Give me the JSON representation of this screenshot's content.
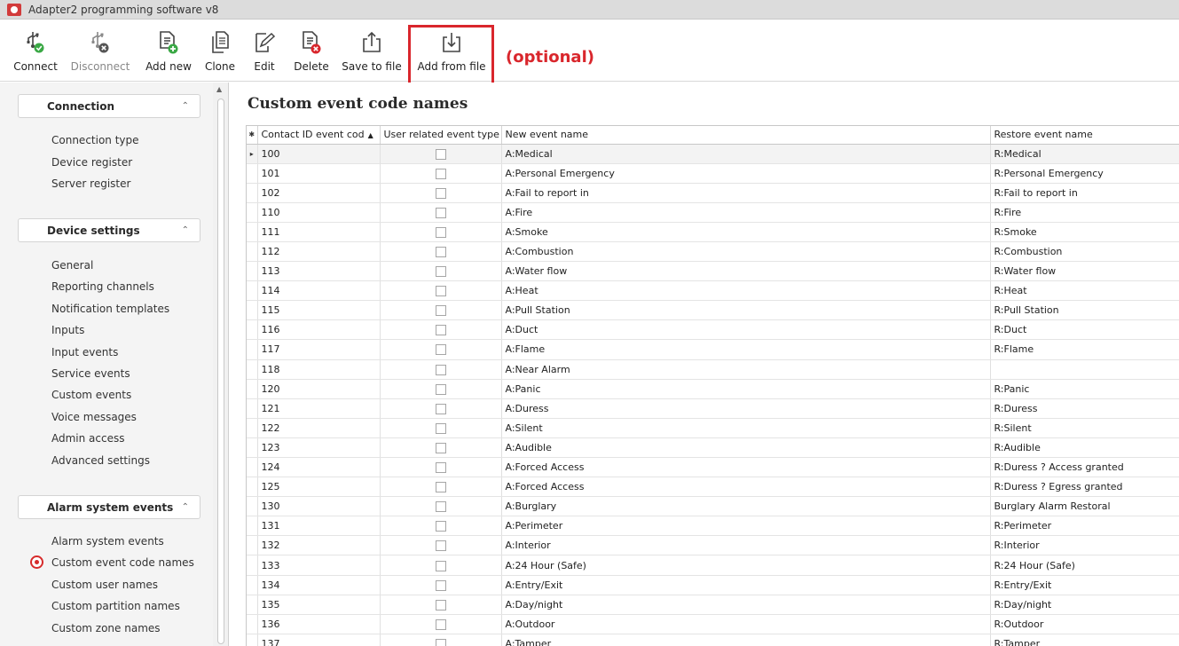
{
  "window": {
    "title": "Adapter2 programming software v8"
  },
  "toolbar": {
    "buttons": [
      {
        "id": "connect",
        "label": "Connect",
        "icon": "usb-connect-icon",
        "enabled": true
      },
      {
        "id": "disconnect",
        "label": "Disconnect",
        "icon": "usb-disconnect-icon",
        "enabled": false
      },
      {
        "id": "add-new",
        "label": "Add new",
        "icon": "document-add-icon",
        "enabled": true
      },
      {
        "id": "clone",
        "label": "Clone",
        "icon": "document-copy-icon",
        "enabled": true
      },
      {
        "id": "edit",
        "label": "Edit",
        "icon": "document-edit-icon",
        "enabled": true
      },
      {
        "id": "delete",
        "label": "Delete",
        "icon": "document-delete-icon",
        "enabled": true
      },
      {
        "id": "save-to-file",
        "label": "Save to file",
        "icon": "export-icon",
        "enabled": true
      },
      {
        "id": "add-from-file",
        "label": "Add from file",
        "icon": "import-icon",
        "enabled": true
      }
    ],
    "annotation": "(optional)"
  },
  "sidebar": {
    "sections": [
      {
        "title": "Connection",
        "items": [
          "Connection type",
          "Device register",
          "Server register"
        ]
      },
      {
        "title": "Device settings",
        "items": [
          "General",
          "Reporting channels",
          "Notification templates",
          "Inputs",
          "Input events",
          "Service events",
          "Custom events",
          "Voice messages",
          "Admin access",
          "Advanced settings"
        ]
      },
      {
        "title": "Alarm system events",
        "items": [
          "Alarm system events",
          "Custom event code names",
          "Custom user names",
          "Custom partition names",
          "Custom zone names"
        ]
      }
    ],
    "selected_item": "Custom event code names"
  },
  "main": {
    "title": "Custom event code names",
    "columns": [
      "Contact ID event cod",
      "User related event type",
      "New event name",
      "Restore event name"
    ],
    "sorted_column": "Contact ID event cod",
    "rows": [
      {
        "code": "100",
        "user_related": false,
        "new_name": "A:Medical",
        "restore_name": "R:Medical"
      },
      {
        "code": "101",
        "user_related": false,
        "new_name": "A:Personal Emergency",
        "restore_name": "R:Personal Emergency"
      },
      {
        "code": "102",
        "user_related": false,
        "new_name": "A:Fail to report in",
        "restore_name": "R:Fail to report in"
      },
      {
        "code": "110",
        "user_related": false,
        "new_name": "A:Fire",
        "restore_name": "R:Fire"
      },
      {
        "code": "111",
        "user_related": false,
        "new_name": "A:Smoke",
        "restore_name": "R:Smoke"
      },
      {
        "code": "112",
        "user_related": false,
        "new_name": "A:Combustion",
        "restore_name": "R:Combustion"
      },
      {
        "code": "113",
        "user_related": false,
        "new_name": "A:Water flow",
        "restore_name": "R:Water flow"
      },
      {
        "code": "114",
        "user_related": false,
        "new_name": "A:Heat",
        "restore_name": "R:Heat"
      },
      {
        "code": "115",
        "user_related": false,
        "new_name": "A:Pull Station",
        "restore_name": "R:Pull Station"
      },
      {
        "code": "116",
        "user_related": false,
        "new_name": "A:Duct",
        "restore_name": "R:Duct"
      },
      {
        "code": "117",
        "user_related": false,
        "new_name": "A:Flame",
        "restore_name": "R:Flame"
      },
      {
        "code": "118",
        "user_related": false,
        "new_name": "A:Near Alarm",
        "restore_name": ""
      },
      {
        "code": "120",
        "user_related": false,
        "new_name": "A:Panic",
        "restore_name": "R:Panic"
      },
      {
        "code": "121",
        "user_related": false,
        "new_name": "A:Duress",
        "restore_name": "R:Duress"
      },
      {
        "code": "122",
        "user_related": false,
        "new_name": "A:Silent",
        "restore_name": "R:Silent"
      },
      {
        "code": "123",
        "user_related": false,
        "new_name": "A:Audible",
        "restore_name": "R:Audible"
      },
      {
        "code": "124",
        "user_related": false,
        "new_name": "A:Forced Access",
        "restore_name": "R:Duress ? Access granted"
      },
      {
        "code": "125",
        "user_related": false,
        "new_name": "A:Forced Access",
        "restore_name": "R:Duress ? Egress granted"
      },
      {
        "code": "130",
        "user_related": false,
        "new_name": "A:Burglary",
        "restore_name": "Burglary Alarm Restoral"
      },
      {
        "code": "131",
        "user_related": false,
        "new_name": "A:Perimeter",
        "restore_name": "R:Perimeter"
      },
      {
        "code": "132",
        "user_related": false,
        "new_name": "A:Interior",
        "restore_name": "R:Interior"
      },
      {
        "code": "133",
        "user_related": false,
        "new_name": "A:24 Hour (Safe)",
        "restore_name": "R:24 Hour (Safe)"
      },
      {
        "code": "134",
        "user_related": false,
        "new_name": "A:Entry/Exit",
        "restore_name": "R:Entry/Exit"
      },
      {
        "code": "135",
        "user_related": false,
        "new_name": "A:Day/night",
        "restore_name": "R:Day/night"
      },
      {
        "code": "136",
        "user_related": false,
        "new_name": "A:Outdoor",
        "restore_name": "R:Outdoor"
      },
      {
        "code": "137",
        "user_related": false,
        "new_name": "A:Tamper",
        "restore_name": "R:Tamper"
      }
    ],
    "selected_row": "100"
  },
  "colors": {
    "accent_red": "#d9262c",
    "icon_green": "#3aa845",
    "icon_grey": "#444444"
  }
}
